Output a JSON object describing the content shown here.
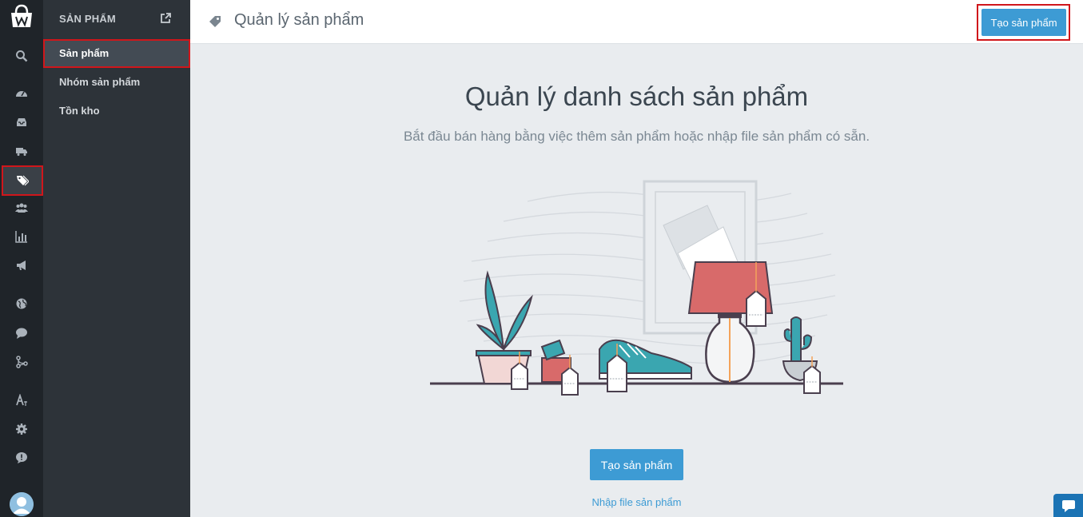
{
  "sidebar": {
    "section_title": "SẢN PHẨM",
    "items": [
      {
        "label": "Sản phẩm",
        "active": true
      },
      {
        "label": "Nhóm sản phẩm",
        "active": false
      },
      {
        "label": "Tồn kho",
        "active": false
      }
    ]
  },
  "rail": {
    "icons": [
      "logo-icon",
      "search-icon",
      "dashboard-icon",
      "inbox-icon",
      "truck-icon",
      "tags-icon",
      "users-icon",
      "bar-chart-icon",
      "megaphone-icon",
      "globe-icon",
      "chat-icon",
      "share-icon",
      "translate-icon",
      "gear-icon",
      "help-icon",
      "avatar"
    ],
    "active": "tags-icon"
  },
  "header": {
    "title": "Quản lý sản phẩm",
    "create_button": "Tạo sản phẩm"
  },
  "main": {
    "title": "Quản lý danh sách sản phẩm",
    "subtitle": "Bắt đầu bán hàng bằng việc thêm sản phẩm hoặc nhập file sản phẩm có sẵn.",
    "create_button": "Tạo sản phẩm",
    "import_link": "Nhập file sản phẩm"
  },
  "colors": {
    "accent": "#3d9bd4",
    "highlight": "#d0161b",
    "rail_bg": "#1f2429",
    "sidebar_bg": "#2d3339"
  }
}
